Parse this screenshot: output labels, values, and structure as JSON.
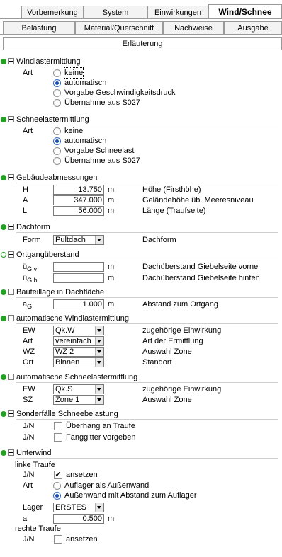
{
  "tabs_row1": [
    "Vorbemerkung",
    "System",
    "Einwirkungen",
    "Wind/Schnee"
  ],
  "tabs_row2": [
    "Belastung",
    "Material/Querschnitt",
    "Nachweise",
    "Ausgabe"
  ],
  "tabs_row3": [
    "Erläuterung"
  ],
  "windlast": {
    "title": "Windlastermittlung",
    "label": "Art",
    "options": [
      "keine",
      "automatisch",
      "Vorgabe Geschwindigkeitsdruck",
      "Übernahme aus S027"
    ],
    "selected": "automatisch"
  },
  "schneelast": {
    "title": "Schneelastermittlung",
    "label": "Art",
    "options": [
      "keine",
      "automatisch",
      "Vorgabe Schneelast",
      "Übernahme aus S027"
    ],
    "selected": "automatisch"
  },
  "gebaeude": {
    "title": "Gebäudeabmessungen",
    "rows": [
      {
        "sym": "H",
        "value": "13.750",
        "unit": "m",
        "desc": "Höhe (Firsthöhe)"
      },
      {
        "sym": "A",
        "value": "347.000",
        "unit": "m",
        "desc": "Geländehöhe üb. Meeresniveau"
      },
      {
        "sym": "L",
        "value": "56.000",
        "unit": "m",
        "desc": "Länge (Traufseite)"
      }
    ]
  },
  "dachform": {
    "title": "Dachform",
    "label": "Form",
    "value": "Pultdach",
    "desc": "Dachform"
  },
  "ortgang": {
    "title": "Ortgangüberstand",
    "rows": [
      {
        "sym": "ü",
        "sub": "G v",
        "value": "",
        "unit": "m",
        "desc": "Dachüberstand Giebelseite vorne"
      },
      {
        "sym": "ü",
        "sub": "G h",
        "value": "",
        "unit": "m",
        "desc": "Dachüberstand Giebelseite hinten"
      }
    ]
  },
  "bauteillage": {
    "title": "Bauteillage in Dachfläche",
    "sym": "a",
    "sub": "G",
    "value": "1.000",
    "unit": "m",
    "desc": "Abstand zum Ortgang"
  },
  "autowind": {
    "title": "automatische Windlastermittlung",
    "rows": [
      {
        "label": "EW",
        "value": "Qk.W",
        "desc": "zugehörige Einwirkung"
      },
      {
        "label": "Art",
        "value": "vereinfach",
        "desc": "Art der Ermittlung"
      },
      {
        "label": "WZ",
        "value": "WZ 2",
        "desc": "Auswahl Zone"
      },
      {
        "label": "Ort",
        "value": "Binnen",
        "desc": "Standort"
      }
    ]
  },
  "autoschnee": {
    "title": "automatische Schneelastermittlung",
    "rows": [
      {
        "label": "EW",
        "value": "Qk.S",
        "desc": "zugehörige Einwirkung"
      },
      {
        "label": "SZ",
        "value": "Zone 1",
        "desc": "Auswahl Zone"
      }
    ]
  },
  "sonderfaelle": {
    "title": "Sonderfälle Schneebelastung",
    "rows": [
      {
        "label": "J/N",
        "text": "Überhang an Traufe",
        "checked": false
      },
      {
        "label": "J/N",
        "text": "Fanggitter vorgeben",
        "checked": false
      }
    ]
  },
  "unterwind": {
    "title": "Unterwind",
    "linke": "linke Traufe",
    "jn": "J/N",
    "ansetzen": "ansetzen",
    "art": "Art",
    "opt1": "Auflager als Außenwand",
    "opt2": "Außenwand mit Abstand zum Auflager",
    "lager_label": "Lager",
    "lager_value": "ERSTES",
    "a_label": "a",
    "a_value": "0.500",
    "a_unit": "m",
    "rechte": "rechte Traufe",
    "jn2": "J/N",
    "ansetzen2": "ansetzen",
    "check_mark": "✓"
  },
  "colors": {
    "status_green": "#21a321",
    "radio_blue": "#1a4fb0"
  }
}
